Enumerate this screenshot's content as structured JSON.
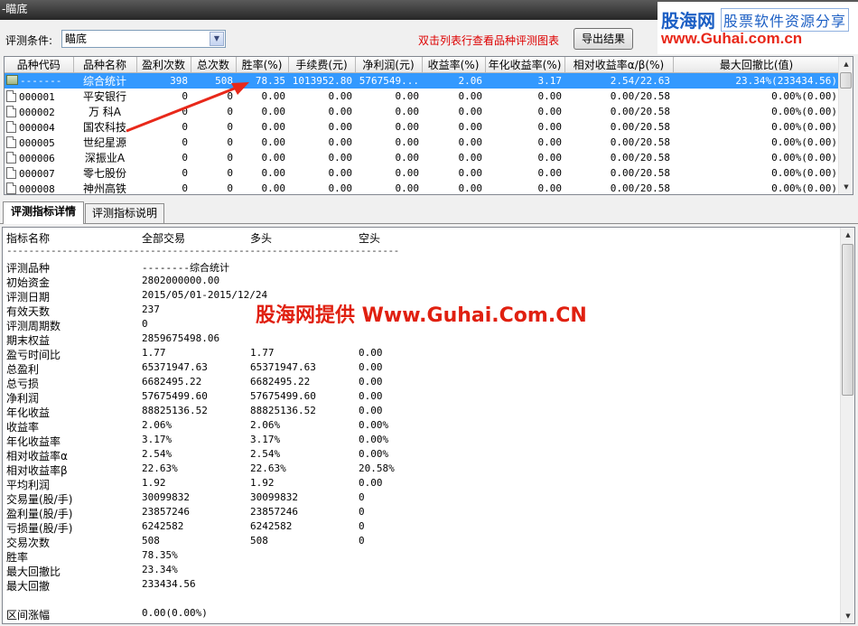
{
  "window": {
    "title": "-瞄底"
  },
  "logo": {
    "main": "股海网",
    "sub": "股票软件资源分享",
    "url": "www.Guhai.com.cn"
  },
  "toolbar": {
    "condition_label": "评测条件:",
    "condition_value": "瞄底",
    "hint": "双击列表行查看品种评测图表",
    "export_label": "导出结果"
  },
  "grid": {
    "columns": [
      "品种代码",
      "品种名称",
      "盈利次数",
      "总次数",
      "胜率(%)",
      "手续费(元)",
      "净利润(元)",
      "收益率(%)",
      "年化收益率(%)",
      "相对收益率α/β(%)",
      "最大回撤比(值)"
    ],
    "rows": [
      {
        "code": "-------",
        "name": "综合统计",
        "wins": "398",
        "total": "508",
        "rate": "78.35",
        "fee": "1013952.80",
        "profit": "5767549...",
        "ret": "2.06",
        "annual": "3.17",
        "rel": "2.54/22.63",
        "dd": "23.34%(233434.56)",
        "selected": true
      },
      {
        "code": "000001",
        "name": "平安银行",
        "wins": "0",
        "total": "0",
        "rate": "0.00",
        "fee": "0.00",
        "profit": "0.00",
        "ret": "0.00",
        "annual": "0.00",
        "rel": "0.00/20.58",
        "dd": "0.00%(0.00)"
      },
      {
        "code": "000002",
        "name": "万  科A",
        "wins": "0",
        "total": "0",
        "rate": "0.00",
        "fee": "0.00",
        "profit": "0.00",
        "ret": "0.00",
        "annual": "0.00",
        "rel": "0.00/20.58",
        "dd": "0.00%(0.00)"
      },
      {
        "code": "000004",
        "name": "国农科技",
        "wins": "0",
        "total": "0",
        "rate": "0.00",
        "fee": "0.00",
        "profit": "0.00",
        "ret": "0.00",
        "annual": "0.00",
        "rel": "0.00/20.58",
        "dd": "0.00%(0.00)"
      },
      {
        "code": "000005",
        "name": "世纪星源",
        "wins": "0",
        "total": "0",
        "rate": "0.00",
        "fee": "0.00",
        "profit": "0.00",
        "ret": "0.00",
        "annual": "0.00",
        "rel": "0.00/20.58",
        "dd": "0.00%(0.00)"
      },
      {
        "code": "000006",
        "name": "深振业A",
        "wins": "0",
        "total": "0",
        "rate": "0.00",
        "fee": "0.00",
        "profit": "0.00",
        "ret": "0.00",
        "annual": "0.00",
        "rel": "0.00/20.58",
        "dd": "0.00%(0.00)"
      },
      {
        "code": "000007",
        "name": "零七股份",
        "wins": "0",
        "total": "0",
        "rate": "0.00",
        "fee": "0.00",
        "profit": "0.00",
        "ret": "0.00",
        "annual": "0.00",
        "rel": "0.00/20.58",
        "dd": "0.00%(0.00)"
      },
      {
        "code": "000008",
        "name": "神州高铁",
        "wins": "0",
        "total": "0",
        "rate": "0.00",
        "fee": "0.00",
        "profit": "0.00",
        "ret": "0.00",
        "annual": "0.00",
        "rel": "0.00/20.58",
        "dd": "0.00%(0.00)"
      }
    ]
  },
  "tabs": [
    {
      "label": "评测指标详情",
      "active": true
    },
    {
      "label": "评测指标说明",
      "active": false
    }
  ],
  "detail": {
    "header": [
      "指标名称",
      "全部交易",
      "多头",
      "空头"
    ],
    "divider": "-----------------------------------------------------------------------",
    "rows": [
      [
        "评测品种",
        "--------综合统计",
        "",
        ""
      ],
      [
        "初始资金",
        "2802000000.00",
        "",
        ""
      ],
      [
        "评测日期",
        "2015/05/01-2015/12/24",
        "",
        ""
      ],
      [
        "有效天数",
        "237",
        "",
        ""
      ],
      [
        "评测周期数",
        "0",
        "",
        ""
      ],
      [
        "期末权益",
        "2859675498.06",
        "",
        ""
      ],
      [
        "盈亏时间比",
        "1.77",
        "1.77",
        "0.00"
      ],
      [
        "总盈利",
        "65371947.63",
        "65371947.63",
        "0.00"
      ],
      [
        "总亏损",
        "6682495.22",
        "6682495.22",
        "0.00"
      ],
      [
        "净利润",
        "57675499.60",
        "57675499.60",
        "0.00"
      ],
      [
        "年化收益",
        "88825136.52",
        "88825136.52",
        "0.00"
      ],
      [
        "收益率",
        "2.06%",
        "2.06%",
        "0.00%"
      ],
      [
        "年化收益率",
        "3.17%",
        "3.17%",
        "0.00%"
      ],
      [
        "相对收益率α",
        "2.54%",
        "2.54%",
        "0.00%"
      ],
      [
        "相对收益率β",
        "22.63%",
        "22.63%",
        "20.58%"
      ],
      [
        "平均利润",
        "1.92",
        "1.92",
        "0.00"
      ],
      [
        "交易量(股/手)",
        "30099832",
        "30099832",
        "0"
      ],
      [
        "盈利量(股/手)",
        "23857246",
        "23857246",
        "0"
      ],
      [
        "亏损量(股/手)",
        "6242582",
        "6242582",
        "0"
      ],
      [
        "交易次数",
        "508",
        "508",
        "0"
      ],
      [
        "胜率",
        "78.35%",
        "",
        ""
      ],
      [
        "最大回撤比",
        "23.34%",
        "",
        ""
      ],
      [
        "最大回撤",
        "233434.56",
        "",
        ""
      ],
      [
        "",
        "",
        "",
        ""
      ],
      [
        "区间涨幅",
        "0.00(0.00%)",
        "",
        ""
      ]
    ]
  },
  "watermark": "股海网提供 Www.Guhai.Com.CN",
  "colors": {
    "selection": "#3399ff",
    "hint_red": "#dd0000",
    "arrow_red": "#e8281a"
  }
}
